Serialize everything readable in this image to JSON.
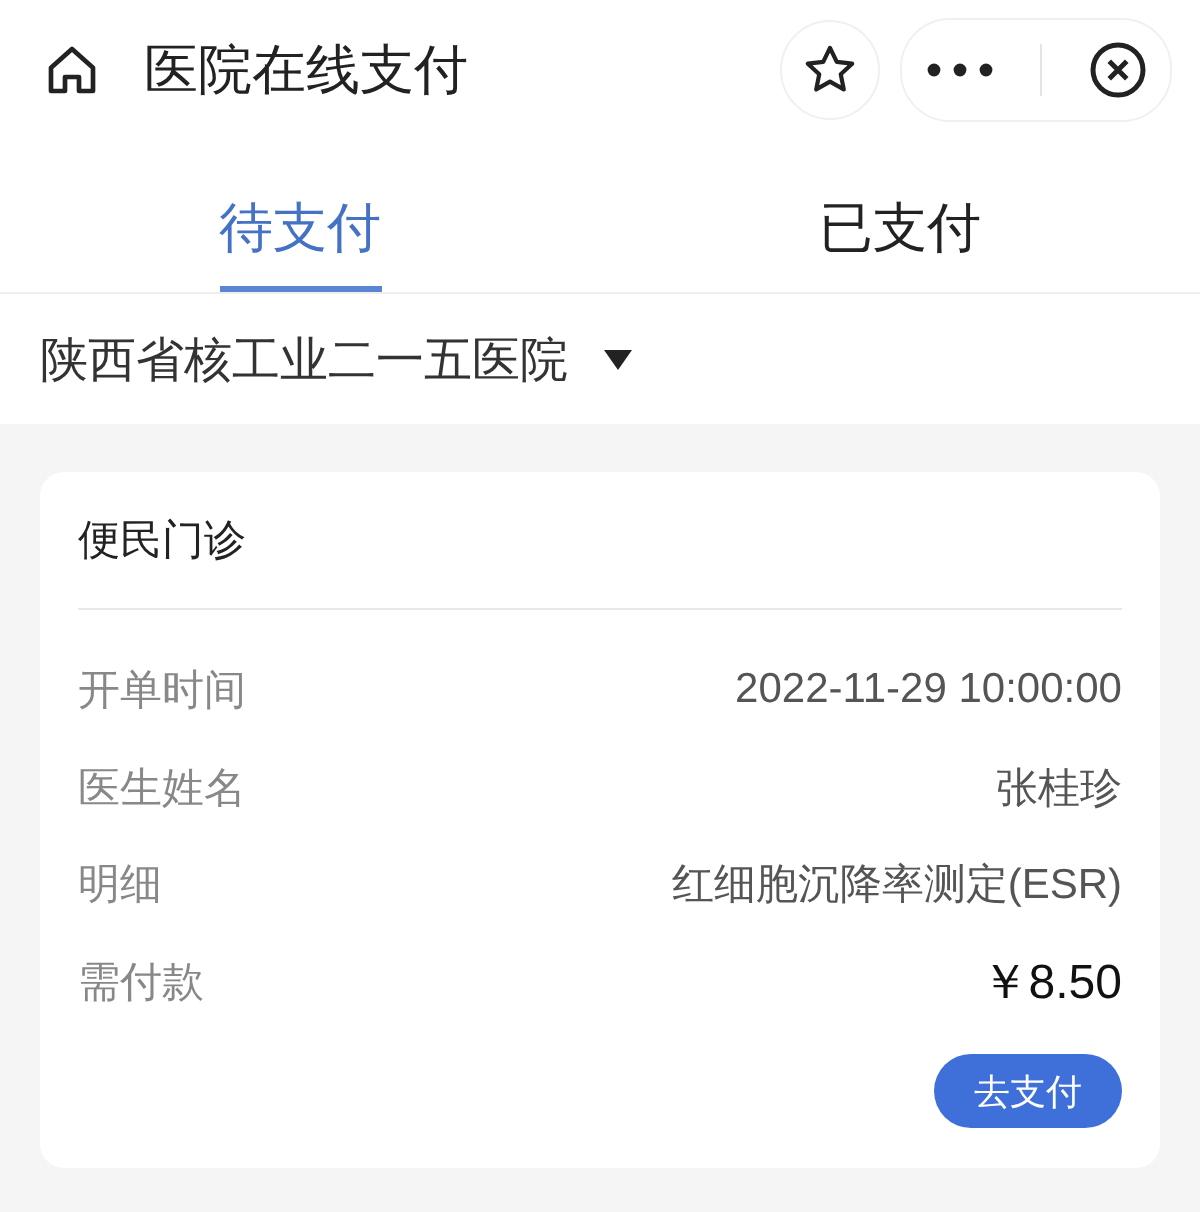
{
  "header": {
    "title": "医院在线支付"
  },
  "tabs": [
    {
      "label": "待支付",
      "selected": true
    },
    {
      "label": "已支付",
      "selected": false
    }
  ],
  "hospital_selector": {
    "value": "陕西省核工业二一五医院"
  },
  "orders": [
    {
      "title": "便民门诊",
      "fields": [
        {
          "label": "开单时间",
          "value": "2022-11-29 10:00:00",
          "kind": "plain"
        },
        {
          "label": "医生姓名",
          "value": "张桂珍",
          "kind": "plain"
        },
        {
          "label": "明细",
          "value": "红细胞沉降率测定(ESR)",
          "kind": "plain"
        },
        {
          "label": "需付款",
          "value": "￥8.50",
          "kind": "amount"
        }
      ],
      "action": "去支付"
    }
  ]
}
